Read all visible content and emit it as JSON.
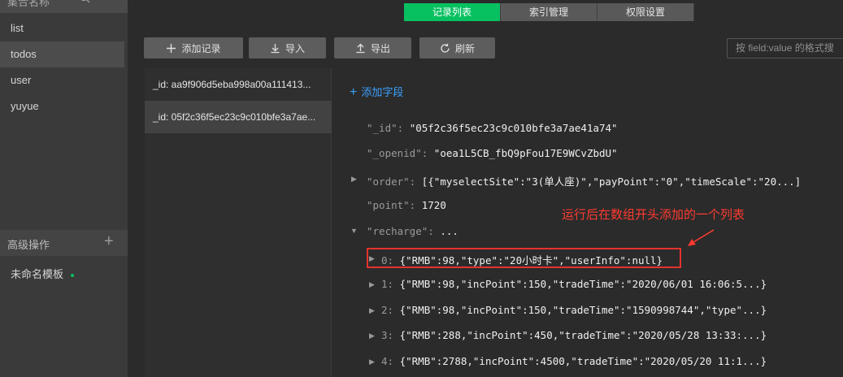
{
  "sidebar": {
    "header_label": "集合名称",
    "collections": [
      "list",
      "todos",
      "user",
      "yuyue"
    ],
    "active_collection": "todos",
    "advanced_label": "高级操作",
    "template_label": "未命名模板"
  },
  "tabs": [
    {
      "label": "记录列表",
      "active": true
    },
    {
      "label": "索引管理",
      "active": false
    },
    {
      "label": "权限设置",
      "active": false
    }
  ],
  "toolbar": {
    "add_record": "添加记录",
    "import": "导入",
    "export": "导出",
    "refresh": "刷新",
    "search_placeholder": "按 field:value 的格式搜"
  },
  "records": [
    {
      "label": "_id: aa9f906d5eba998a00a111413..."
    },
    {
      "label": "_id: 05f2c36f5ec23c9c010bfe3a7ae..."
    }
  ],
  "detail": {
    "add_field": "添加字段",
    "fields": {
      "id_key": "\"_id\":",
      "id_val": "\"05f2c36f5ec23c9c010bfe3a7ae41a74\"",
      "openid_key": "\"_openid\":",
      "openid_val": "\"oea1L5CB_fbQ9pFou17E9WCvZbdU\"",
      "order_key": "\"order\":",
      "order_val": "[{\"myselectSite\":\"3(单人座)\",\"payPoint\":\"0\",\"timeScale\":\"20...]",
      "point_key": "\"point\":",
      "point_val": "1720",
      "recharge_key": "\"recharge\":",
      "recharge_val": "..."
    },
    "recharge_items": [
      {
        "idx": "0:",
        "val": "{\"RMB\":98,\"type\":\"20小时卡\",\"userInfo\":null}"
      },
      {
        "idx": "1:",
        "val": "{\"RMB\":98,\"incPoint\":150,\"tradeTime\":\"2020/06/01 16:06:5...}"
      },
      {
        "idx": "2:",
        "val": "{\"RMB\":98,\"incPoint\":150,\"tradeTime\":\"1590998744\",\"type\"...}"
      },
      {
        "idx": "3:",
        "val": "{\"RMB\":288,\"incPoint\":450,\"tradeTime\":\"2020/05/28 13:33:...}"
      },
      {
        "idx": "4:",
        "val": "{\"RMB\":2788,\"incPoint\":4500,\"tradeTime\":\"2020/05/20 11:1...}"
      }
    ]
  },
  "annotation": {
    "text": "运行后在数组开头添加的一个列表",
    "color": "#ff3b30"
  },
  "colors": {
    "accent": "#07c160",
    "link": "#3ba0ff",
    "highlight": "#e5322d"
  }
}
